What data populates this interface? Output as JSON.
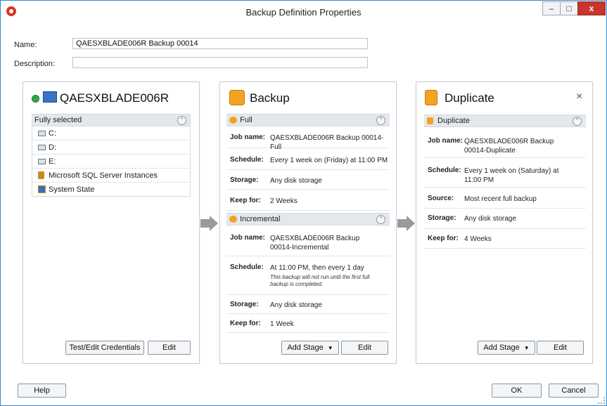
{
  "window": {
    "title": "Backup Definition Properties",
    "minimize": "–",
    "maximize": "□",
    "close": "x"
  },
  "form": {
    "name_label": "Name:",
    "name_value": "QAESXBLADE006R Backup 00014",
    "description_label": "Description:",
    "description_value": ""
  },
  "source_panel": {
    "title": "QAESXBLADE006R",
    "section": "Fully selected",
    "items": [
      "C:",
      "D:",
      "E:",
      "Microsoft SQL Server Instances",
      "System State"
    ],
    "credentials_button": "Test/Edit Credentials",
    "edit_button": "Edit"
  },
  "backup_panel": {
    "title": "Backup",
    "full": {
      "section": "Full",
      "job_name_label": "Job name:",
      "job_name": "QAESXBLADE006R Backup 00014-Full",
      "schedule_label": "Schedule:",
      "schedule": "Every 1 week on (Friday) at 11:00 PM",
      "storage_label": "Storage:",
      "storage": "Any disk storage",
      "keep_label": "Keep for:",
      "keep": "2 Weeks"
    },
    "incremental": {
      "section": "Incremental",
      "job_name_label": "Job name:",
      "job_name": "QAESXBLADE006R Backup 00014-Incremental",
      "schedule_label": "Schedule:",
      "schedule": "At 11:00 PM, then every 1 day",
      "note": "This backup will not run until the first full backup is completed.",
      "storage_label": "Storage:",
      "storage": "Any disk storage",
      "keep_label": "Keep for:",
      "keep": "1 Week"
    },
    "add_stage_button": "Add Stage",
    "edit_button": "Edit"
  },
  "duplicate_panel": {
    "title": "Duplicate",
    "close": "×",
    "section": "Duplicate",
    "job_name_label": "Job name:",
    "job_name": "QAESXBLADE006R Backup 00014-Duplicate",
    "schedule_label": "Schedule:",
    "schedule": "Every 1 week on (Saturday) at 11:00 PM",
    "source_label": "Source:",
    "source": "Most recent full backup",
    "storage_label": "Storage:",
    "storage": "Any disk storage",
    "keep_label": "Keep for:",
    "keep": "4 Weeks",
    "add_stage_button": "Add Stage",
    "edit_button": "Edit"
  },
  "footer": {
    "help": "Help",
    "ok": "OK",
    "cancel": "Cancel"
  },
  "colors": {
    "accent_border": "#2b8bd9",
    "close_red": "#c7352b",
    "status_green": "#2fa84f",
    "brand_orange": "#f3a321"
  }
}
